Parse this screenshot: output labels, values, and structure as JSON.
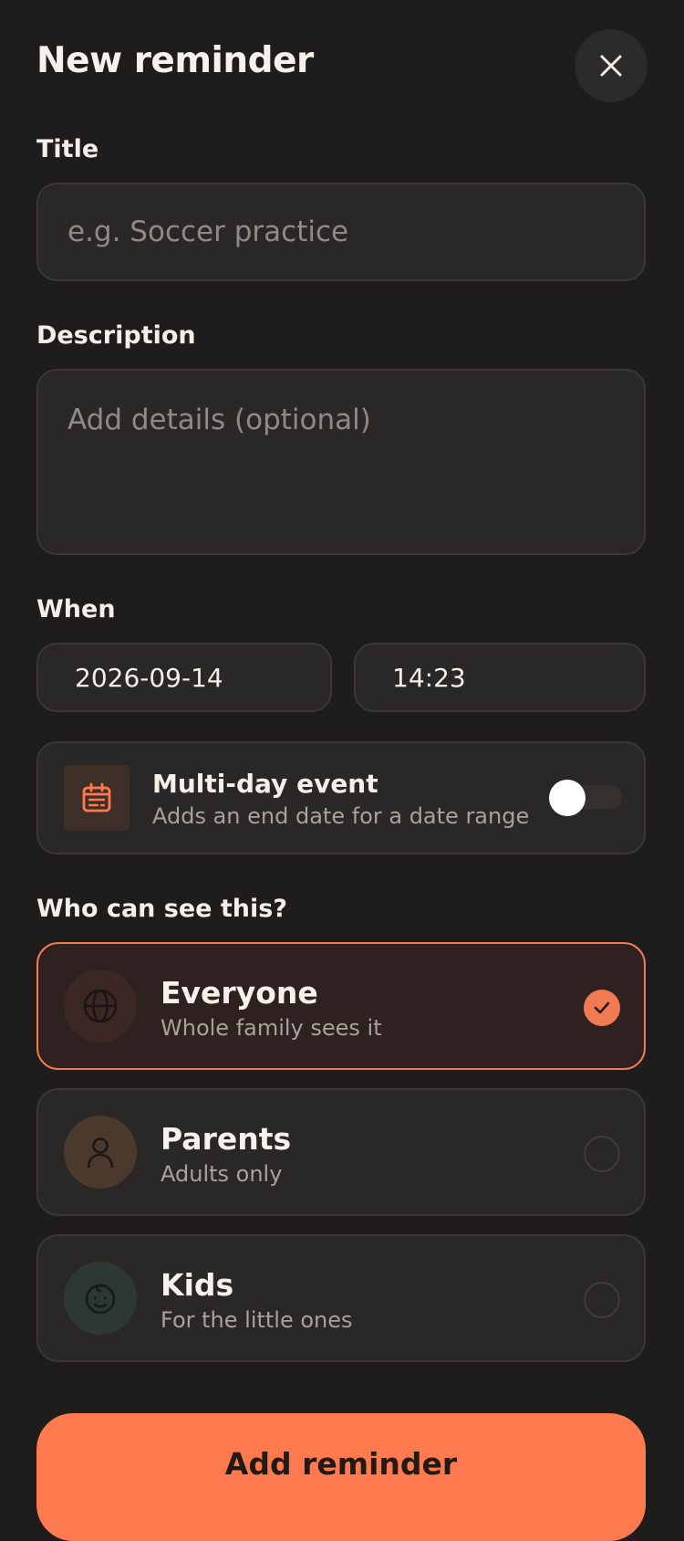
{
  "header": {
    "title": "New reminder",
    "close_icon": "close-icon"
  },
  "title_field": {
    "label": "Title",
    "placeholder": "e.g. Soccer practice",
    "value": ""
  },
  "description_field": {
    "label": "Description",
    "placeholder": "Add details (optional)",
    "value": ""
  },
  "when": {
    "label": "When",
    "date": "2026-09-14",
    "time": "14:23"
  },
  "multi_day": {
    "title": "Multi-day event",
    "subtitle": "Adds an end date for a date range",
    "icon": "calendar-icon",
    "enabled": false
  },
  "visibility": {
    "label": "Who can see this?",
    "options": [
      {
        "title": "Everyone",
        "subtitle": "Whole family sees it",
        "icon": "globe-icon",
        "selected": true
      },
      {
        "title": "Parents",
        "subtitle": "Adults only",
        "icon": "person-icon",
        "selected": false
      },
      {
        "title": "Kids",
        "subtitle": "For the little ones",
        "icon": "baby-face-icon",
        "selected": false
      }
    ]
  },
  "submit": {
    "label": "Add reminder"
  },
  "colors": {
    "background": "#1e1d1c",
    "card": "#2a2826",
    "accent": "#ff7b4f",
    "selected_border": "#f07a52",
    "muted_text": "#a8a29b"
  }
}
